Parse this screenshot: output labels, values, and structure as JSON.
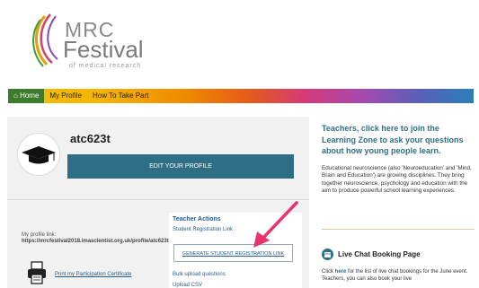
{
  "logo": {
    "line1": "MRC",
    "line2": "Festival",
    "line3": "of medical research"
  },
  "nav": {
    "items": [
      {
        "label": "Home",
        "icon": "home-icon"
      },
      {
        "label": "My Profile"
      },
      {
        "label": "How To Take Part"
      }
    ],
    "colors": {
      "home_bg": "#3e7a2c"
    }
  },
  "profile": {
    "username": "atc623t",
    "edit_label": "EDIT YOUR PROFILE",
    "link_label": "My profile link:",
    "link_url": "https://mrcfestival2018.imascientist.org.uk/profile/atc623t/",
    "print_label": "Print my Participation Certificate"
  },
  "teacher_actions": {
    "title": "Teacher Actions",
    "student_reg_label": "Student Registration Link",
    "generate_label": "GENERATE STUDENT REGISTRATION LINK",
    "bulk_label": "Bulk upload questions",
    "upload_label": "Upload CSV"
  },
  "sidebar": {
    "teachers_link": "Teachers, click here to join the Learning Zone to ask your questions about how young people learn.",
    "neuro_text": "Educational neuroscience (also 'Neuroeducation' and 'Mind, Brain and Education') are growing disciplines. They bring together neuroscience, psychology and education with the aim to produce powerful school learning experiences.",
    "chat_title": "Live Chat Booking Page",
    "chat_text_prefix": "Click ",
    "chat_text_here": "here",
    "chat_text_suffix": " for the list of live chat bookings for the June event. Teachers, you can also book your live"
  },
  "colors": {
    "accent": "#2f6f86",
    "annotation_arrow": "#e8336d"
  }
}
